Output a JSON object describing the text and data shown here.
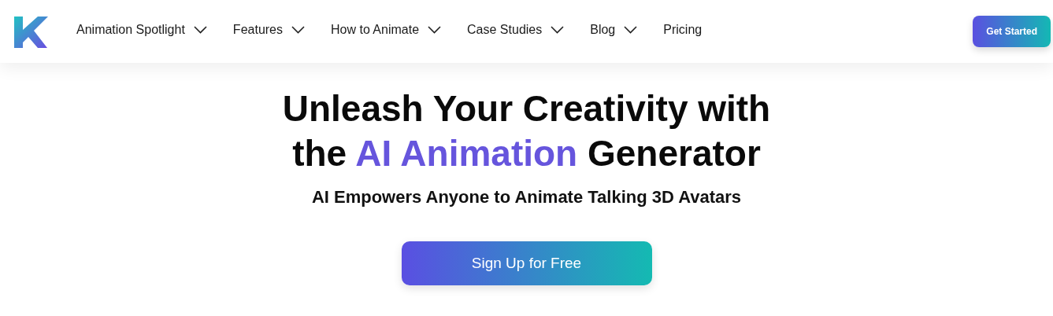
{
  "nav": {
    "items": [
      {
        "label": "Animation Spotlight",
        "dropdown": true
      },
      {
        "label": "Features",
        "dropdown": true
      },
      {
        "label": "How to Animate",
        "dropdown": true
      },
      {
        "label": "Case Studies",
        "dropdown": true
      },
      {
        "label": "Blog",
        "dropdown": true
      },
      {
        "label": "Pricing",
        "dropdown": false
      }
    ],
    "cta": "Get Started"
  },
  "hero": {
    "headline_line_1": "Unleash Your Creativity with",
    "headline_line_2": {
      "before": "the ",
      "highlight": "AI Animation",
      "after": " Generator"
    },
    "subtitle": "AI Empowers Anyone to Animate Talking 3D Avatars",
    "button": "Sign Up for Free"
  }
}
